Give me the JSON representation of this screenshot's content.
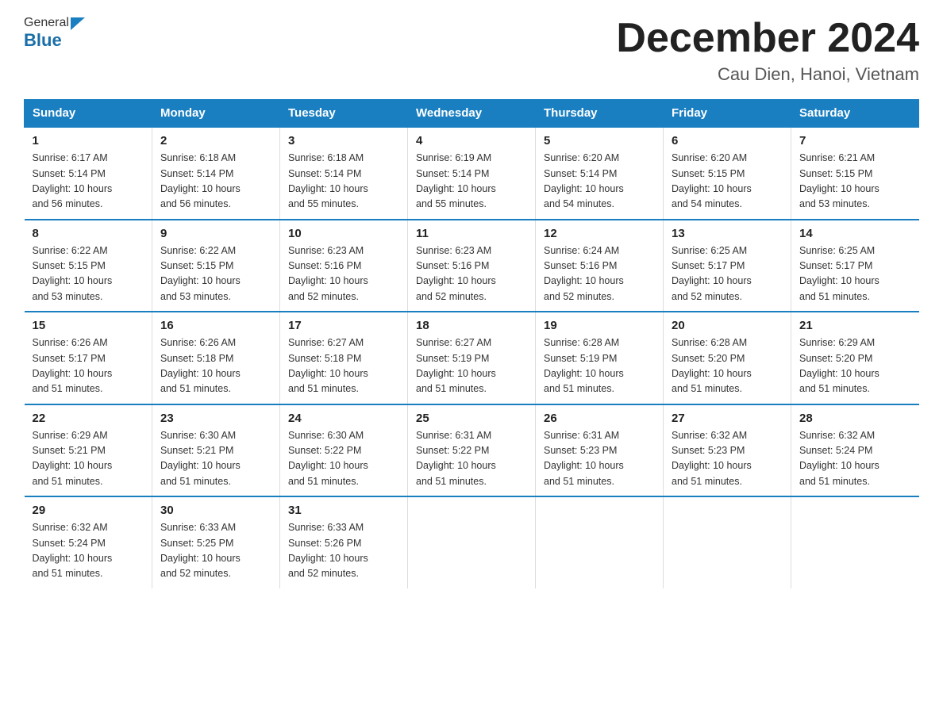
{
  "logo": {
    "general": "General",
    "blue": "Blue"
  },
  "title": {
    "month_year": "December 2024",
    "location": "Cau Dien, Hanoi, Vietnam"
  },
  "headers": [
    "Sunday",
    "Monday",
    "Tuesday",
    "Wednesday",
    "Thursday",
    "Friday",
    "Saturday"
  ],
  "weeks": [
    [
      {
        "day": "1",
        "sunrise": "6:17 AM",
        "sunset": "5:14 PM",
        "daylight": "10 hours and 56 minutes."
      },
      {
        "day": "2",
        "sunrise": "6:18 AM",
        "sunset": "5:14 PM",
        "daylight": "10 hours and 56 minutes."
      },
      {
        "day": "3",
        "sunrise": "6:18 AM",
        "sunset": "5:14 PM",
        "daylight": "10 hours and 55 minutes."
      },
      {
        "day": "4",
        "sunrise": "6:19 AM",
        "sunset": "5:14 PM",
        "daylight": "10 hours and 55 minutes."
      },
      {
        "day": "5",
        "sunrise": "6:20 AM",
        "sunset": "5:14 PM",
        "daylight": "10 hours and 54 minutes."
      },
      {
        "day": "6",
        "sunrise": "6:20 AM",
        "sunset": "5:15 PM",
        "daylight": "10 hours and 54 minutes."
      },
      {
        "day": "7",
        "sunrise": "6:21 AM",
        "sunset": "5:15 PM",
        "daylight": "10 hours and 53 minutes."
      }
    ],
    [
      {
        "day": "8",
        "sunrise": "6:22 AM",
        "sunset": "5:15 PM",
        "daylight": "10 hours and 53 minutes."
      },
      {
        "day": "9",
        "sunrise": "6:22 AM",
        "sunset": "5:15 PM",
        "daylight": "10 hours and 53 minutes."
      },
      {
        "day": "10",
        "sunrise": "6:23 AM",
        "sunset": "5:16 PM",
        "daylight": "10 hours and 52 minutes."
      },
      {
        "day": "11",
        "sunrise": "6:23 AM",
        "sunset": "5:16 PM",
        "daylight": "10 hours and 52 minutes."
      },
      {
        "day": "12",
        "sunrise": "6:24 AM",
        "sunset": "5:16 PM",
        "daylight": "10 hours and 52 minutes."
      },
      {
        "day": "13",
        "sunrise": "6:25 AM",
        "sunset": "5:17 PM",
        "daylight": "10 hours and 52 minutes."
      },
      {
        "day": "14",
        "sunrise": "6:25 AM",
        "sunset": "5:17 PM",
        "daylight": "10 hours and 51 minutes."
      }
    ],
    [
      {
        "day": "15",
        "sunrise": "6:26 AM",
        "sunset": "5:17 PM",
        "daylight": "10 hours and 51 minutes."
      },
      {
        "day": "16",
        "sunrise": "6:26 AM",
        "sunset": "5:18 PM",
        "daylight": "10 hours and 51 minutes."
      },
      {
        "day": "17",
        "sunrise": "6:27 AM",
        "sunset": "5:18 PM",
        "daylight": "10 hours and 51 minutes."
      },
      {
        "day": "18",
        "sunrise": "6:27 AM",
        "sunset": "5:19 PM",
        "daylight": "10 hours and 51 minutes."
      },
      {
        "day": "19",
        "sunrise": "6:28 AM",
        "sunset": "5:19 PM",
        "daylight": "10 hours and 51 minutes."
      },
      {
        "day": "20",
        "sunrise": "6:28 AM",
        "sunset": "5:20 PM",
        "daylight": "10 hours and 51 minutes."
      },
      {
        "day": "21",
        "sunrise": "6:29 AM",
        "sunset": "5:20 PM",
        "daylight": "10 hours and 51 minutes."
      }
    ],
    [
      {
        "day": "22",
        "sunrise": "6:29 AM",
        "sunset": "5:21 PM",
        "daylight": "10 hours and 51 minutes."
      },
      {
        "day": "23",
        "sunrise": "6:30 AM",
        "sunset": "5:21 PM",
        "daylight": "10 hours and 51 minutes."
      },
      {
        "day": "24",
        "sunrise": "6:30 AM",
        "sunset": "5:22 PM",
        "daylight": "10 hours and 51 minutes."
      },
      {
        "day": "25",
        "sunrise": "6:31 AM",
        "sunset": "5:22 PM",
        "daylight": "10 hours and 51 minutes."
      },
      {
        "day": "26",
        "sunrise": "6:31 AM",
        "sunset": "5:23 PM",
        "daylight": "10 hours and 51 minutes."
      },
      {
        "day": "27",
        "sunrise": "6:32 AM",
        "sunset": "5:23 PM",
        "daylight": "10 hours and 51 minutes."
      },
      {
        "day": "28",
        "sunrise": "6:32 AM",
        "sunset": "5:24 PM",
        "daylight": "10 hours and 51 minutes."
      }
    ],
    [
      {
        "day": "29",
        "sunrise": "6:32 AM",
        "sunset": "5:24 PM",
        "daylight": "10 hours and 51 minutes."
      },
      {
        "day": "30",
        "sunrise": "6:33 AM",
        "sunset": "5:25 PM",
        "daylight": "10 hours and 52 minutes."
      },
      {
        "day": "31",
        "sunrise": "6:33 AM",
        "sunset": "5:26 PM",
        "daylight": "10 hours and 52 minutes."
      },
      null,
      null,
      null,
      null
    ]
  ],
  "labels": {
    "sunrise": "Sunrise:",
    "sunset": "Sunset:",
    "daylight": "Daylight:"
  }
}
